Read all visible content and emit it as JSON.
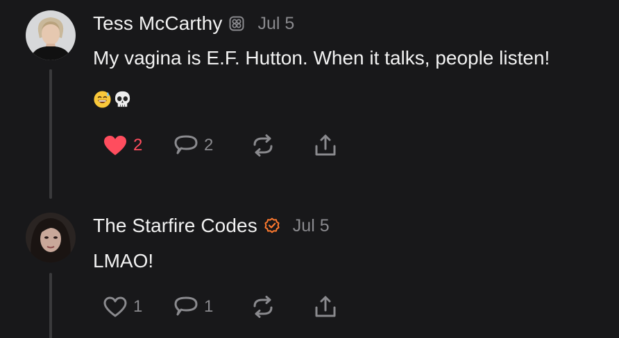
{
  "posts": [
    {
      "author": "Tess McCarthy",
      "badge": "community-badge",
      "date": "Jul 5",
      "text": "My vagina is E.F. Hutton. When it talks, people listen!",
      "emojis": [
        "😅",
        "💀"
      ],
      "liked": true,
      "likes": "2",
      "replies": "2",
      "accent_color": "#ff4d5e"
    },
    {
      "author": "The Starfire Codes",
      "badge": "verified-badge",
      "badge_color": "#ff7a2f",
      "date": "Jul 5",
      "text": "LMAO!",
      "liked": false,
      "likes": "1",
      "replies": "1"
    }
  ],
  "icons": {
    "like": "heart-icon",
    "reply": "comment-icon",
    "repost": "repost-icon",
    "share": "share-icon"
  },
  "colors": {
    "background": "#18181a",
    "text": "#f2f2f2",
    "muted": "#8a8a8e",
    "thread_line": "#3a3a3c"
  }
}
